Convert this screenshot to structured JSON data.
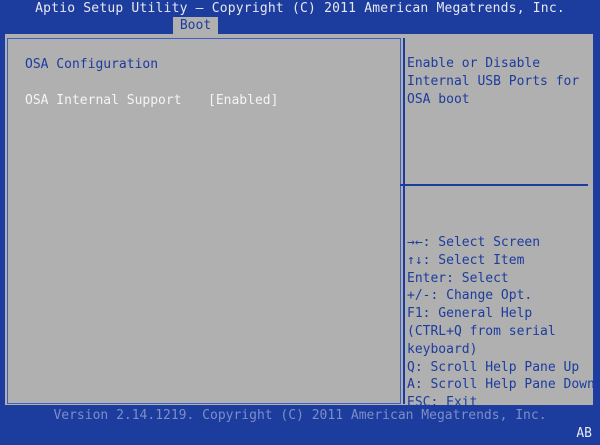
{
  "title_bar": {
    "text": "Aptio Setup Utility – Copyright (C) 2011 American Megatrends, Inc."
  },
  "tabs": [
    {
      "label": "Boot",
      "active": true
    }
  ],
  "main": {
    "section_title": "OSA Configuration",
    "options": [
      {
        "label": "OSA Internal Support",
        "value": "[Enabled]"
      }
    ]
  },
  "help": {
    "lines": [
      "Enable or Disable",
      "Internal USB Ports for",
      "OSA boot"
    ]
  },
  "keys": [
    "→←: Select Screen",
    "↑↓: Select Item",
    "Enter: Select",
    "+/-: Change Opt.",
    "F1: General Help",
    "(CTRL+Q from serial",
    "keyboard)",
    "Q: Scroll Help Pane Up",
    "A: Scroll Help Pane Down",
    "ESC: Exit"
  ],
  "footer": {
    "text": "Version 2.14.1219. Copyright (C) 2011 American Megatrends, Inc."
  },
  "corner_tag": "AB",
  "colors": {
    "background": "#1c3c9e",
    "panel": "#b0b0b0",
    "text_dark": "#1c3c9e",
    "text_light": "#f4f4f8"
  }
}
